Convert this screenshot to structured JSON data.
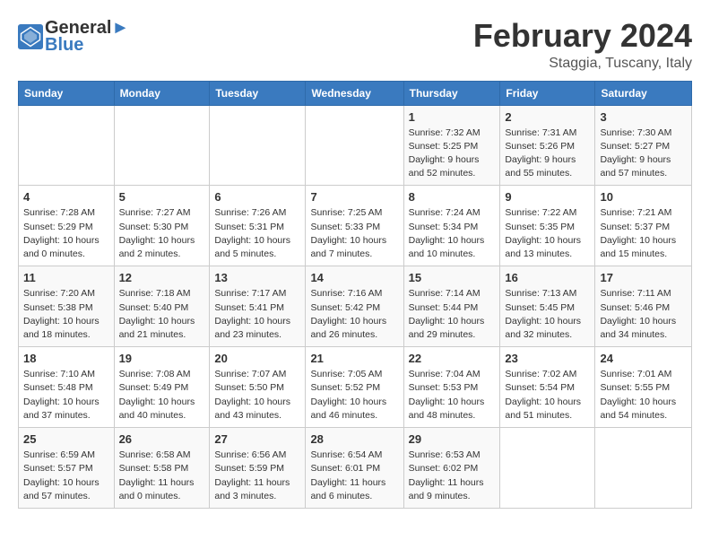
{
  "header": {
    "logo_line1": "General",
    "logo_line2": "Blue",
    "month_year": "February 2024",
    "location": "Staggia, Tuscany, Italy"
  },
  "weekdays": [
    "Sunday",
    "Monday",
    "Tuesday",
    "Wednesday",
    "Thursday",
    "Friday",
    "Saturday"
  ],
  "weeks": [
    [
      {
        "day": "",
        "info": ""
      },
      {
        "day": "",
        "info": ""
      },
      {
        "day": "",
        "info": ""
      },
      {
        "day": "",
        "info": ""
      },
      {
        "day": "1",
        "info": "Sunrise: 7:32 AM\nSunset: 5:25 PM\nDaylight: 9 hours\nand 52 minutes."
      },
      {
        "day": "2",
        "info": "Sunrise: 7:31 AM\nSunset: 5:26 PM\nDaylight: 9 hours\nand 55 minutes."
      },
      {
        "day": "3",
        "info": "Sunrise: 7:30 AM\nSunset: 5:27 PM\nDaylight: 9 hours\nand 57 minutes."
      }
    ],
    [
      {
        "day": "4",
        "info": "Sunrise: 7:28 AM\nSunset: 5:29 PM\nDaylight: 10 hours\nand 0 minutes."
      },
      {
        "day": "5",
        "info": "Sunrise: 7:27 AM\nSunset: 5:30 PM\nDaylight: 10 hours\nand 2 minutes."
      },
      {
        "day": "6",
        "info": "Sunrise: 7:26 AM\nSunset: 5:31 PM\nDaylight: 10 hours\nand 5 minutes."
      },
      {
        "day": "7",
        "info": "Sunrise: 7:25 AM\nSunset: 5:33 PM\nDaylight: 10 hours\nand 7 minutes."
      },
      {
        "day": "8",
        "info": "Sunrise: 7:24 AM\nSunset: 5:34 PM\nDaylight: 10 hours\nand 10 minutes."
      },
      {
        "day": "9",
        "info": "Sunrise: 7:22 AM\nSunset: 5:35 PM\nDaylight: 10 hours\nand 13 minutes."
      },
      {
        "day": "10",
        "info": "Sunrise: 7:21 AM\nSunset: 5:37 PM\nDaylight: 10 hours\nand 15 minutes."
      }
    ],
    [
      {
        "day": "11",
        "info": "Sunrise: 7:20 AM\nSunset: 5:38 PM\nDaylight: 10 hours\nand 18 minutes."
      },
      {
        "day": "12",
        "info": "Sunrise: 7:18 AM\nSunset: 5:40 PM\nDaylight: 10 hours\nand 21 minutes."
      },
      {
        "day": "13",
        "info": "Sunrise: 7:17 AM\nSunset: 5:41 PM\nDaylight: 10 hours\nand 23 minutes."
      },
      {
        "day": "14",
        "info": "Sunrise: 7:16 AM\nSunset: 5:42 PM\nDaylight: 10 hours\nand 26 minutes."
      },
      {
        "day": "15",
        "info": "Sunrise: 7:14 AM\nSunset: 5:44 PM\nDaylight: 10 hours\nand 29 minutes."
      },
      {
        "day": "16",
        "info": "Sunrise: 7:13 AM\nSunset: 5:45 PM\nDaylight: 10 hours\nand 32 minutes."
      },
      {
        "day": "17",
        "info": "Sunrise: 7:11 AM\nSunset: 5:46 PM\nDaylight: 10 hours\nand 34 minutes."
      }
    ],
    [
      {
        "day": "18",
        "info": "Sunrise: 7:10 AM\nSunset: 5:48 PM\nDaylight: 10 hours\nand 37 minutes."
      },
      {
        "day": "19",
        "info": "Sunrise: 7:08 AM\nSunset: 5:49 PM\nDaylight: 10 hours\nand 40 minutes."
      },
      {
        "day": "20",
        "info": "Sunrise: 7:07 AM\nSunset: 5:50 PM\nDaylight: 10 hours\nand 43 minutes."
      },
      {
        "day": "21",
        "info": "Sunrise: 7:05 AM\nSunset: 5:52 PM\nDaylight: 10 hours\nand 46 minutes."
      },
      {
        "day": "22",
        "info": "Sunrise: 7:04 AM\nSunset: 5:53 PM\nDaylight: 10 hours\nand 48 minutes."
      },
      {
        "day": "23",
        "info": "Sunrise: 7:02 AM\nSunset: 5:54 PM\nDaylight: 10 hours\nand 51 minutes."
      },
      {
        "day": "24",
        "info": "Sunrise: 7:01 AM\nSunset: 5:55 PM\nDaylight: 10 hours\nand 54 minutes."
      }
    ],
    [
      {
        "day": "25",
        "info": "Sunrise: 6:59 AM\nSunset: 5:57 PM\nDaylight: 10 hours\nand 57 minutes."
      },
      {
        "day": "26",
        "info": "Sunrise: 6:58 AM\nSunset: 5:58 PM\nDaylight: 11 hours\nand 0 minutes."
      },
      {
        "day": "27",
        "info": "Sunrise: 6:56 AM\nSunset: 5:59 PM\nDaylight: 11 hours\nand 3 minutes."
      },
      {
        "day": "28",
        "info": "Sunrise: 6:54 AM\nSunset: 6:01 PM\nDaylight: 11 hours\nand 6 minutes."
      },
      {
        "day": "29",
        "info": "Sunrise: 6:53 AM\nSunset: 6:02 PM\nDaylight: 11 hours\nand 9 minutes."
      },
      {
        "day": "",
        "info": ""
      },
      {
        "day": "",
        "info": ""
      }
    ]
  ]
}
